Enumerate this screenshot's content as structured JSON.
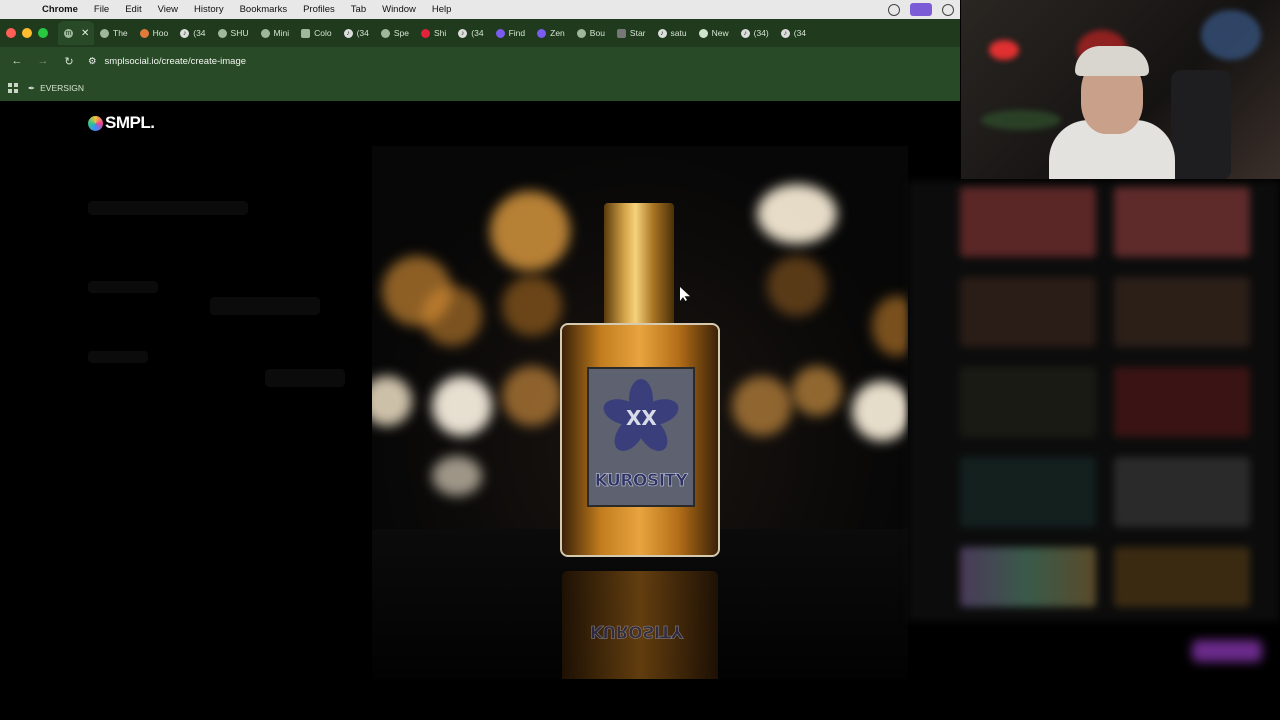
{
  "menubar": {
    "app": "Chrome",
    "items": [
      "File",
      "Edit",
      "View",
      "History",
      "Bookmarks",
      "Profiles",
      "Tab",
      "Window",
      "Help"
    ]
  },
  "tabs": [
    {
      "label": "The",
      "icon": "globe-icon"
    },
    {
      "label": "Hoo",
      "icon": "orange-circle-icon"
    },
    {
      "label": "(34",
      "icon": "tiktok-icon"
    },
    {
      "label": "SHU",
      "icon": "shopify-icon"
    },
    {
      "label": "Mini",
      "icon": "globe-icon"
    },
    {
      "label": "Colo",
      "icon": "square-icon"
    },
    {
      "label": "(34",
      "icon": "tiktok-icon"
    },
    {
      "label": "Spe",
      "icon": "globe-icon"
    },
    {
      "label": "Shi",
      "icon": "youtube-icon"
    },
    {
      "label": "(34",
      "icon": "tiktok-icon"
    },
    {
      "label": "Find",
      "icon": "zapier-icon"
    },
    {
      "label": "Zen",
      "icon": "zen-icon"
    },
    {
      "label": "Bou",
      "icon": "globe-icon"
    },
    {
      "label": "Star",
      "icon": "cube-icon"
    },
    {
      "label": "satu",
      "icon": "tiktok-icon"
    },
    {
      "label": "New",
      "icon": "chrome-icon"
    },
    {
      "label": "(34)",
      "icon": "tiktok-icon"
    },
    {
      "label": "(34",
      "icon": "tiktok-icon"
    }
  ],
  "address": {
    "url": "smplsocial.io/create/create-image"
  },
  "bookmarks": [
    {
      "label": "EVERSIGN"
    }
  ],
  "page": {
    "logo_text": "SMPL.",
    "product_brand": "KUROSITY",
    "product_monogram": "XX"
  }
}
